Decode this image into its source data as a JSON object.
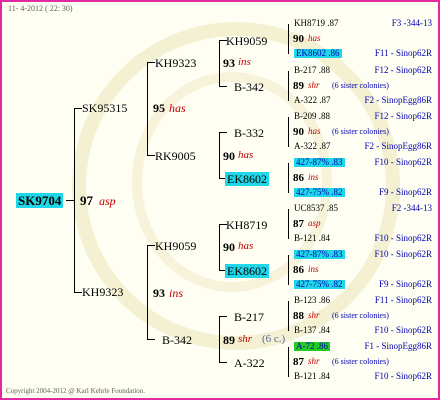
{
  "header": {
    "date": "11-  4-2012 ( 22: 30)"
  },
  "footer": {
    "copyright": "Copyright 2004-2012 @ Karl Kehrle Foundation."
  },
  "root": {
    "id": "SK9704",
    "num": "97",
    "race": "asp"
  },
  "g1": {
    "sire": {
      "id": "SK95315",
      "num": "95",
      "race": "has"
    },
    "dam": {
      "id": "KH9323",
      "num": "93",
      "race": "ins"
    }
  },
  "g2": {
    "a": {
      "id": "KH9323",
      "num": "93",
      "race": "ins"
    },
    "b": {
      "id": "RK9005",
      "num": "90",
      "race": "has"
    },
    "c": {
      "id": "KH9059",
      "num": "90",
      "race": "has"
    },
    "d": {
      "id": "B-342",
      "num": "89",
      "race": "shr",
      "note": "(6 c.)"
    }
  },
  "g3": {
    "a1": {
      "id": "KH9059",
      "num": "90",
      "race": "has"
    },
    "a2": {
      "id": "B-342",
      "num": "89",
      "race": "shr",
      "note": "(6 sister colonies)"
    },
    "b1": {
      "id": "B-332",
      "num": "90",
      "race": "has"
    },
    "b2": {
      "id": "EK8602",
      "num": "86",
      "race": "ins"
    },
    "c1": {
      "id": "KH8719",
      "num": "87",
      "race": "asp"
    },
    "c2": {
      "id": "EK8602",
      "num": "86",
      "race": "ins"
    },
    "d1": {
      "id": "B-217",
      "num": "88",
      "race": "shr",
      "note": "(6 sister colonies)"
    },
    "d2": {
      "id": "A-322",
      "num": "87",
      "race": "shr",
      "note": "(6 sister colonies)"
    }
  },
  "g4": [
    {
      "id": "KH8719 .87",
      "line": "F3 -344-13",
      "hl": ""
    },
    {
      "id": "EK8602 .86",
      "line": "F11 - Sinop62R",
      "hl": "cyan"
    },
    {
      "id": "B-217 .88",
      "line": "F12 - Sinop62R",
      "hl": ""
    },
    {
      "id": "A-322 .87",
      "line": "F2 - SinopEgg86R",
      "hl": ""
    },
    {
      "id": "B-209 .88",
      "line": "F12 - Sinop62R",
      "hl": ""
    },
    {
      "id": "A-322 .87",
      "line": "F2 - SinopEgg86R",
      "hl": ""
    },
    {
      "id": "427-87% .83",
      "line": "F10 - Sinop62R",
      "hl": "cyan"
    },
    {
      "id": "427-75% .82",
      "line": "F9 - Sinop62R",
      "hl": "cyan"
    },
    {
      "id": "UC8537 .85",
      "line": "F2 -344-13",
      "hl": ""
    },
    {
      "id": "B-121 .84",
      "line": "F10 - Sinop62R",
      "hl": ""
    },
    {
      "id": "427-87% .83",
      "line": "F10 - Sinop62R",
      "hl": "cyan"
    },
    {
      "id": "427-75% .82",
      "line": "F9 - Sinop62R",
      "hl": "cyan"
    },
    {
      "id": "B-123 .86",
      "line": "F11 - Sinop62R",
      "hl": ""
    },
    {
      "id": "B-137 .84",
      "line": "F10 - Sinop62R",
      "hl": ""
    },
    {
      "id": "A-72 .86",
      "line": "F1 - SinopEgg86R",
      "hl": "green"
    },
    {
      "id": "B-121 .84",
      "line": "F10 - Sinop62R",
      "hl": ""
    }
  ]
}
